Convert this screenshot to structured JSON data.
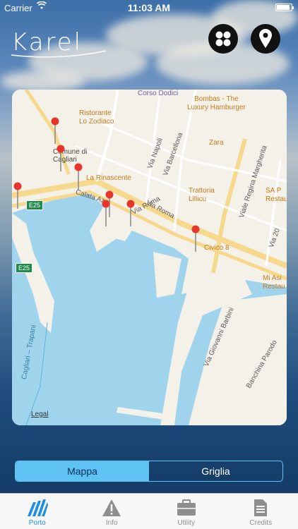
{
  "status_bar": {
    "carrier": "Carrier",
    "time": "11:03 AM"
  },
  "header": {
    "logo_text": "Karel"
  },
  "map": {
    "labels": {
      "corso_dodici": "Corso Dodici",
      "bombas": "Bombas - The\nLuxury Hamburger",
      "ristorante": "Ristorante\nLo Zodiaco",
      "zara": "Zara",
      "comune": "Comune di\nCagliari",
      "rinascente": "La Rinascente",
      "via_napoli": "Via Napoli",
      "via_barcellona": "Via Barcellona",
      "trattoria": "Trattoria\nLillicu",
      "viale_regina": "Viale Regina Margherita",
      "sa_p": "SA P\nRestau",
      "calata": "Calata Az",
      "via_roma_1": "Via Roma",
      "via_roma_2": "Via Roma",
      "civico": "Civico 8",
      "via_20": "Via 20",
      "mi_asi": "Mi Asi\nRestau",
      "e25_a": "E25",
      "e25_b": "E25",
      "via_barbini": "Via Giovanni Barbini",
      "banchina": "Banchina Parodo",
      "trapani": "Cagliari – Trapani",
      "legal": "Legal"
    }
  },
  "segmented": {
    "mappa": "Mappa",
    "griglia": "Griglia"
  },
  "tabbar": {
    "porto": "Porto",
    "info": "Info",
    "utility": "Utility",
    "credits": "Credits"
  },
  "colors": {
    "accent": "#5ec3f3",
    "tab_active": "#1f8fde",
    "pin": "#e8352c",
    "water": "#9fd4ec",
    "land": "#f4f1e8"
  }
}
